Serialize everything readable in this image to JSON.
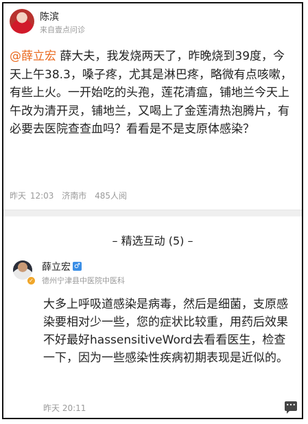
{
  "question": {
    "asker_name": "陈滨",
    "source": "来自壹点问诊",
    "mention": "@薛立宏",
    "body": " 薛大夫，我发烧两天了，昨晚烧到39度，今天上午38.3，嗓子疼，尤其是淋巴疼，略微有点咳嗽，有些上火。一开始吃的头孢，莲花清瘟，铺地兰今天上午改为清开灵，铺地兰，又喝上了金莲清热泡腾片，有必要去医院查查血吗？看看是不是支原体感染？",
    "time": "昨天 12:03",
    "city": "济南市",
    "views": "485人阅"
  },
  "section": {
    "title": "– 精选互动 (5) –"
  },
  "answer": {
    "doctor_name": "薛立宏",
    "gender_icon": "male-icon",
    "hospital": "德州宁津县中医院中医科",
    "body": "大多上呼吸道感染是病毒，然后是细菌，支原感染要相对少一些，您的症状比较重，用药后效果不好最好hassensitiveWord去看看医生，检查一下，因为一些感染性疾病初期表现是近似的。",
    "time": "昨天 20:11",
    "comment_icon": "comment-icon"
  },
  "colors": {
    "mention": "#e96a1f",
    "meta_gray": "#9a9a9a",
    "gender_blue": "#3a8ee6",
    "badge_orange": "#f0a62a"
  }
}
